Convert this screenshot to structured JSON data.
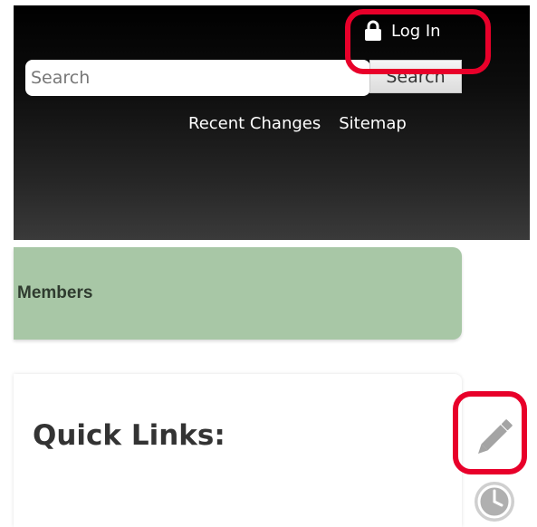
{
  "header": {
    "login_label": "Log In",
    "search": {
      "placeholder": "Search",
      "value": "",
      "button_label": "Search"
    },
    "nav_links": [
      {
        "label": "Recent Changes"
      },
      {
        "label": "Sitemap"
      }
    ]
  },
  "banner": {
    "label": "Members"
  },
  "content": {
    "heading": "Quick Links:"
  },
  "side_actions": {
    "edit_icon": "pencil-icon",
    "history_icon": "clock-icon"
  },
  "colors": {
    "header_bg": "#000000",
    "banner_bg": "#a8c7a6",
    "highlight": "#e8002a"
  }
}
